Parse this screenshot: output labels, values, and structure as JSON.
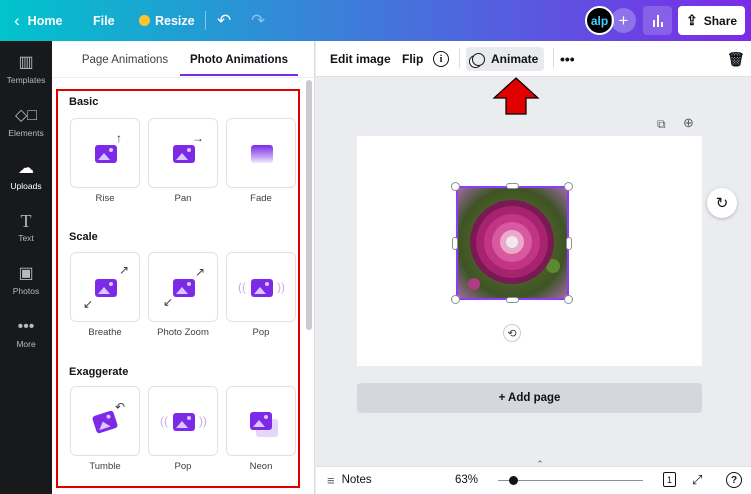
{
  "topbar": {
    "home_label": "Home",
    "file_label": "File",
    "resize_label": "Resize",
    "avatar_text": "alp",
    "share_label": "Share"
  },
  "rail": {
    "items": [
      {
        "label": "Templates",
        "icon": "templates-icon"
      },
      {
        "label": "Elements",
        "icon": "elements-icon"
      },
      {
        "label": "Uploads",
        "icon": "uploads-icon"
      },
      {
        "label": "Text",
        "icon": "text-icon"
      },
      {
        "label": "Photos",
        "icon": "photos-icon"
      },
      {
        "label": "More",
        "icon": "more-icon"
      }
    ],
    "active_index": 2
  },
  "panel": {
    "tabs": [
      {
        "label": "Page Animations"
      },
      {
        "label": "Photo Animations"
      }
    ],
    "active_tab": 1,
    "sections": [
      {
        "title": "Basic",
        "items": [
          {
            "label": "Rise"
          },
          {
            "label": "Pan"
          },
          {
            "label": "Fade"
          }
        ]
      },
      {
        "title": "Scale",
        "items": [
          {
            "label": "Breathe"
          },
          {
            "label": "Photo Zoom"
          },
          {
            "label": "Pop"
          }
        ]
      },
      {
        "title": "Exaggerate",
        "items": [
          {
            "label": "Tumble"
          },
          {
            "label": "Pop"
          },
          {
            "label": "Neon"
          }
        ]
      }
    ]
  },
  "toolbar": {
    "edit_image_label": "Edit image",
    "flip_label": "Flip",
    "animate_label": "Animate"
  },
  "canvas": {
    "add_page_label": "+ Add page"
  },
  "bottombar": {
    "notes_label": "Notes",
    "zoom_label": "63%",
    "page_count": "1",
    "help_label": "?"
  },
  "colors": {
    "accent": "#7d2ae8",
    "annotation": "#e00000"
  }
}
